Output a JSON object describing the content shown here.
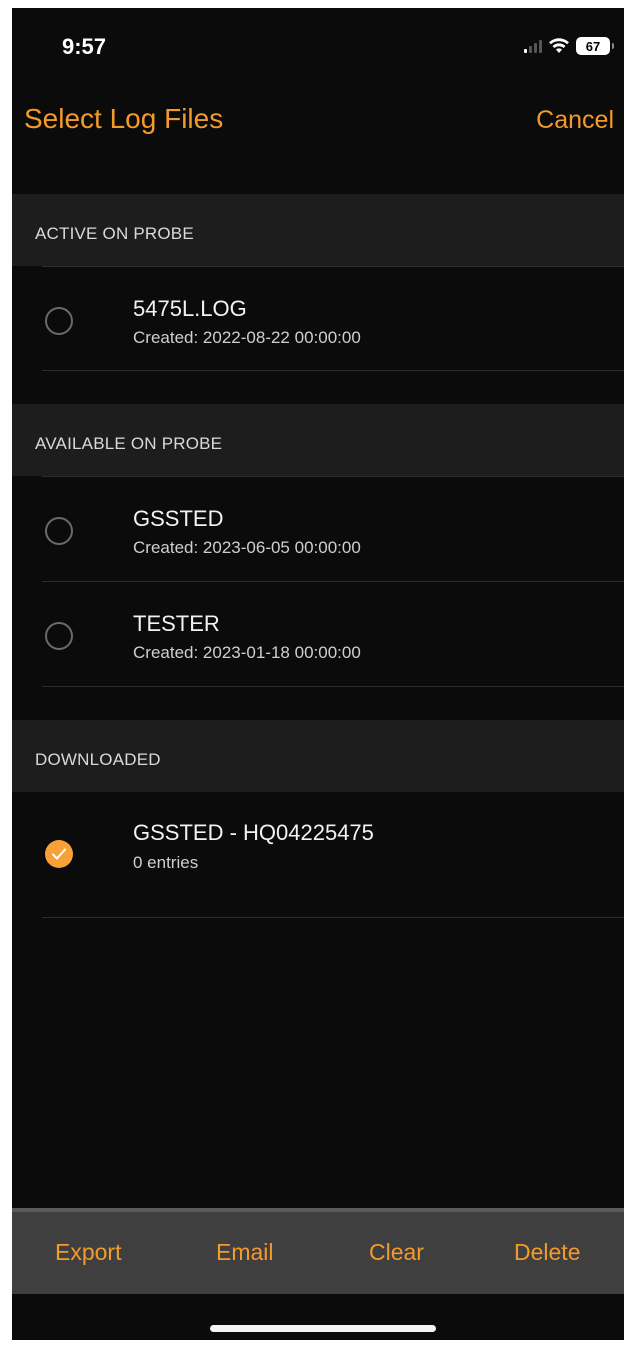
{
  "status_bar": {
    "time": "9:57",
    "battery": "67"
  },
  "nav": {
    "title": "Select Log Files",
    "cancel_label": "Cancel"
  },
  "sections": [
    {
      "header": "ACTIVE ON PROBE",
      "items": [
        {
          "name": "5475L.LOG",
          "detail": "Created: 2022-08-22 00:00:00",
          "selected": false
        }
      ]
    },
    {
      "header": "AVAILABLE ON PROBE",
      "items": [
        {
          "name": "GSSTED",
          "detail": "Created: 2023-06-05 00:00:00",
          "selected": false
        },
        {
          "name": "TESTER",
          "detail": "Created: 2023-01-18 00:00:00",
          "selected": false
        }
      ]
    },
    {
      "header": "DOWNLOADED",
      "items": [
        {
          "name": "GSSTED - HQ04225475",
          "detail": "0 entries",
          "selected": true
        }
      ]
    }
  ],
  "toolbar": {
    "export_label": "Export",
    "email_label": "Email",
    "clear_label": "Clear",
    "delete_label": "Delete"
  },
  "colors": {
    "accent": "#f39a2b",
    "background": "#0b0b0b",
    "section_header_bg": "#1d1d1d",
    "toolbar_bg": "#3f3f3f"
  }
}
